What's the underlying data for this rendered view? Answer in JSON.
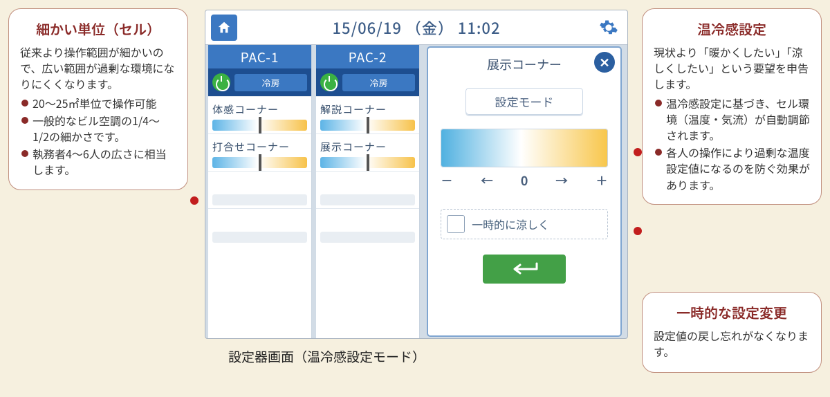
{
  "caption": "設定器画面（温冷感設定モード）",
  "annotations": {
    "left": {
      "title": "細かい単位（セル）",
      "lead": "従来より操作範囲が細かいので、広い範囲が過剰な環境になりにくくなります。",
      "bullets": [
        "20～25㎡単位で操作可能",
        "一般的なビル空調の1/4～1/2の細かさです。",
        "執務者4～6人の広さに相当します。"
      ]
    },
    "topRight": {
      "title": "温冷感設定",
      "lead": "現状より「暖かくしたい」「涼しくしたい」という要望を申告します。",
      "bullets": [
        "温冷感設定に基づき、セル環境（温度・気流）が自動調節されます。",
        "各人の操作により過剰な温度設定値になるのを防ぐ効果があります。"
      ]
    },
    "bottomRight": {
      "title": "一時的な設定変更",
      "lead": "設定値の戻し忘れがなくなります。"
    }
  },
  "device": {
    "clock": "15/06/19 （金） 11:02",
    "columns": [
      {
        "head": "PAC-1",
        "chip": "冷房",
        "zones": [
          "体感コーナー",
          "打合せコーナー",
          "",
          ""
        ]
      },
      {
        "head": "PAC-2",
        "chip": "冷房",
        "zones": [
          "解説コーナー",
          "展示コーナー",
          "",
          ""
        ]
      }
    ],
    "panel": {
      "title": "展示コーナー",
      "mode": "設定モード",
      "ticks": [
        "－",
        "←",
        "0",
        "→",
        "＋"
      ],
      "override": "一時的に涼しく"
    }
  }
}
